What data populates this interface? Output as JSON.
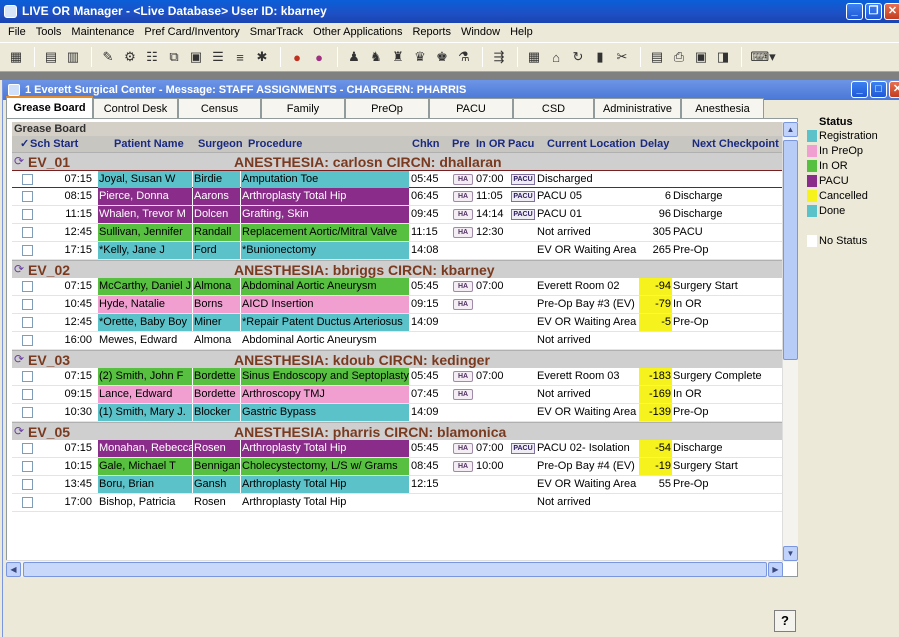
{
  "app": {
    "title": "LIVE OR Manager - <Live Database> User ID: kbarney"
  },
  "menu": [
    "File",
    "Tools",
    "Maintenance",
    "Pref Card/Inventory",
    "SmarTrack",
    "Other Applications",
    "Reports",
    "Window",
    "Help"
  ],
  "child_window": {
    "title": "1 Everett Surgical Center - Message: STAFF ASSIGNMENTS - CHARGERN: PHARRIS"
  },
  "tabs": [
    "Grease Board",
    "Control Desk",
    "Census",
    "Family",
    "PreOp",
    "PACU",
    "CSD",
    "Administrative",
    "Anesthesia"
  ],
  "active_tab": "Grease Board",
  "grid": {
    "title": "Grease Board",
    "columns": [
      "Sch Start",
      "Patient Name",
      "Surgeon",
      "Procedure",
      "Chkn",
      "Pre",
      "In OR",
      "Pacu",
      "Current Location",
      "Delay",
      "Next Checkpoint"
    ],
    "groups": [
      {
        "room": "EV_01",
        "info": "ANESTHESIA: carlosn CIRCN: dhallaran",
        "rows": [
          {
            "start": "07:15",
            "patient": "Joyal, Susan W",
            "surgeon": "Birdie",
            "procedure": "Amputation Toe",
            "chkn": "05:45",
            "pre": "HA",
            "inor": "07:00",
            "pacu": "PACU",
            "location": "Discharged",
            "delay": "",
            "next": "",
            "status": "done",
            "selected": true
          },
          {
            "start": "08:15",
            "patient": "Pierce, Donna",
            "surgeon": "Aarons",
            "procedure": "Arthroplasty Total Hip",
            "chkn": "06:45",
            "pre": "HA",
            "inor": "11:05",
            "pacu": "PACU",
            "location": "PACU 05",
            "delay": "6",
            "next": "Discharge",
            "status": "pacu"
          },
          {
            "start": "11:15",
            "patient": "Whalen, Trevor M",
            "surgeon": "Dolcen",
            "procedure": "Grafting, Skin",
            "chkn": "09:45",
            "pre": "HA",
            "inor": "14:14",
            "pacu": "PACU",
            "location": "PACU 01",
            "delay": "96",
            "next": "Discharge",
            "status": "pacu"
          },
          {
            "start": "12:45",
            "patient": "Sullivan, Jennifer",
            "surgeon": "Randall",
            "procedure": "Replacement Aortic/Mitral Valve",
            "chkn": "11:15",
            "pre": "HA",
            "inor": "12:30",
            "pacu": "",
            "location": "Not arrived",
            "delay": "305",
            "next": "PACU",
            "status": "inor"
          },
          {
            "start": "17:15",
            "patient": "*Kelly, Jane J",
            "surgeon": "Ford",
            "procedure": "*Bunionectomy",
            "chkn": "14:08",
            "pre": "",
            "inor": "",
            "pacu": "",
            "location": "EV OR Waiting Area",
            "delay": "265",
            "next": "Pre-Op",
            "status": "registration"
          }
        ]
      },
      {
        "room": "EV_02",
        "info": "ANESTHESIA: bbriggs CIRCN: kbarney",
        "rows": [
          {
            "start": "07:15",
            "patient": "McCarthy, Daniel J",
            "surgeon": "Almona",
            "procedure": "Abdominal Aortic Aneurysm",
            "chkn": "05:45",
            "pre": "HA",
            "inor": "07:00",
            "pacu": "",
            "location": "Everett Room 02",
            "delay": "-94",
            "next": "Surgery Start",
            "status": "inor",
            "delay_flag": true
          },
          {
            "start": "10:45",
            "patient": "Hyde, Natalie",
            "surgeon": "Borns",
            "procedure": "AICD Insertion",
            "chkn": "09:15",
            "pre": "HA",
            "inor": "",
            "pacu": "",
            "location": "Pre-Op Bay #3 (EV)",
            "delay": "-79",
            "next": "In OR",
            "status": "preop",
            "delay_flag": true
          },
          {
            "start": "12:45",
            "patient": "*Orette, Baby Boy",
            "surgeon": "Miner",
            "procedure": "*Repair Patent Ductus Arteriosus",
            "chkn": "14:09",
            "pre": "",
            "inor": "",
            "pacu": "",
            "location": "EV OR Waiting Area",
            "delay": "-5",
            "next": "Pre-Op",
            "status": "registration",
            "delay_flag": true
          },
          {
            "start": "16:00",
            "patient": "Mewes, Edward",
            "surgeon": "Almona",
            "procedure": "Abdominal Aortic Aneurysm",
            "chkn": "",
            "pre": "",
            "inor": "",
            "pacu": "",
            "location": "Not arrived",
            "delay": "",
            "next": "",
            "status": "none"
          }
        ]
      },
      {
        "room": "EV_03",
        "info": "ANESTHESIA: kdoub CIRCN: kedinger",
        "rows": [
          {
            "start": "07:15",
            "patient": "(2) Smith, John F",
            "surgeon": "Bordette",
            "procedure": "Sinus Endoscopy and Septoplasty",
            "chkn": "05:45",
            "pre": "HA",
            "inor": "07:00",
            "pacu": "",
            "location": "Everett Room 03",
            "delay": "-183",
            "next": "Surgery Complete",
            "status": "inor",
            "delay_flag": true
          },
          {
            "start": "09:15",
            "patient": "Lance, Edward",
            "surgeon": "Bordette",
            "procedure": "Arthroscopy TMJ",
            "chkn": "07:45",
            "pre": "HA",
            "inor": "",
            "pacu": "",
            "location": "Not arrived",
            "delay": "-169",
            "next": "In OR",
            "status": "preop",
            "delay_flag": true
          },
          {
            "start": "10:30",
            "patient": "(1) Smith, Mary J.",
            "surgeon": "Blocker",
            "procedure": "Gastric Bypass",
            "chkn": "14:09",
            "pre": "",
            "inor": "",
            "pacu": "",
            "location": "EV OR Waiting Area",
            "delay": "-139",
            "next": "Pre-Op",
            "status": "registration",
            "delay_flag": true
          }
        ]
      },
      {
        "room": "EV_05",
        "info": "ANESTHESIA: pharris CIRCN: blamonica",
        "rows": [
          {
            "start": "07:15",
            "patient": "Monahan, Rebecca",
            "surgeon": "Rosen",
            "procedure": "Arthroplasty Total Hip",
            "chkn": "05:45",
            "pre": "HA",
            "inor": "07:00",
            "pacu": "PACU",
            "location": "PACU 02- Isolation",
            "delay": "-54",
            "next": "Discharge",
            "status": "pacu",
            "delay_flag": true
          },
          {
            "start": "10:15",
            "patient": "Gale, Michael T",
            "surgeon": "Bennigan",
            "procedure": "Cholecystectomy, L/S w/ Grams",
            "chkn": "08:45",
            "pre": "HA",
            "inor": "10:00",
            "pacu": "",
            "location": "Pre-Op Bay #4 (EV)",
            "delay": "-19",
            "next": "Surgery Start",
            "status": "inor",
            "delay_flag": true
          },
          {
            "start": "13:45",
            "patient": "Boru, Brian",
            "surgeon": "Gansh",
            "procedure": "Arthroplasty Total Hip",
            "chkn": "12:15",
            "pre": "",
            "inor": "",
            "pacu": "",
            "location": "EV OR Waiting Area",
            "delay": "55",
            "next": "Pre-Op",
            "status": "registration"
          },
          {
            "start": "17:00",
            "patient": "Bishop, Patricia",
            "surgeon": "Rosen",
            "procedure": "Arthroplasty Total Hip",
            "chkn": "",
            "pre": "",
            "inor": "",
            "pacu": "",
            "location": "Not arrived",
            "delay": "",
            "next": "",
            "status": "none"
          }
        ]
      }
    ]
  },
  "legend": {
    "title": "Status",
    "items": [
      {
        "label": "Registration",
        "color": "#5bc2c9"
      },
      {
        "label": "In PreOp",
        "color": "#f09fd0"
      },
      {
        "label": "In OR",
        "color": "#58c040"
      },
      {
        "label": "PACU",
        "color": "#8a2d8a"
      },
      {
        "label": "Cancelled",
        "color": "#f6f21e"
      },
      {
        "label": "Done",
        "color": "#5bc2c9"
      },
      {
        "label": "No Status",
        "color": "#ffffff"
      }
    ]
  },
  "colors": {
    "registration": "#5bc2c9",
    "preop": "#f09fd0",
    "inor": "#58c040",
    "pacu": "#8a2d8a",
    "done": "#5bc2c9",
    "delay_flag": "#f6f21e"
  }
}
